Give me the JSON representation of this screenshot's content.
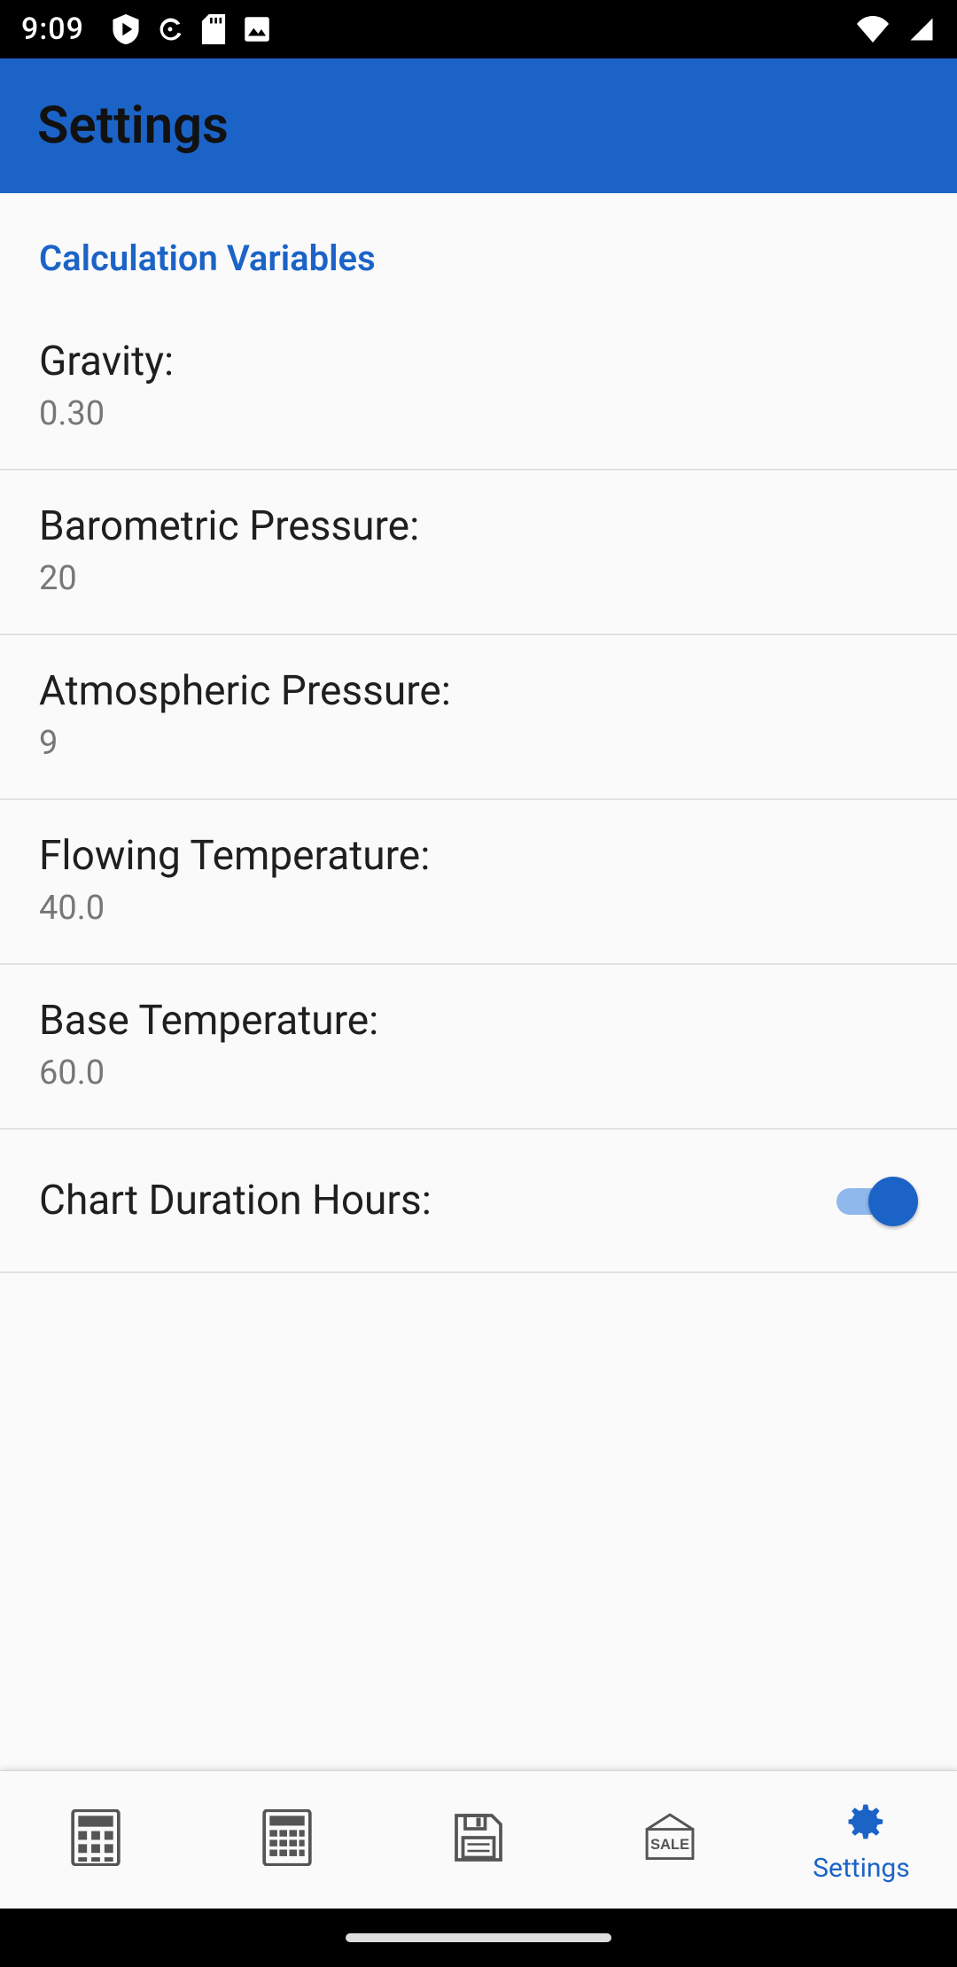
{
  "status": {
    "time": "9:09",
    "icons_left": [
      "play-shield-icon",
      "sync-icon",
      "sd-card-icon",
      "picture-icon"
    ],
    "icons_right": [
      "wifi-icon",
      "cell-signal-icon"
    ]
  },
  "header": {
    "title": "Settings"
  },
  "section": {
    "title": "Calculation Variables"
  },
  "settings": [
    {
      "label": "Gravity:",
      "value": "0.30"
    },
    {
      "label": "Barometric Pressure:",
      "value": "20"
    },
    {
      "label": "Atmospheric Pressure:",
      "value": "9"
    },
    {
      "label": "Flowing Temperature:",
      "value": "40.0"
    },
    {
      "label": "Base Temperature:",
      "value": "60.0"
    }
  ],
  "toggle": {
    "label": "Chart Duration Hours:",
    "on": true
  },
  "nav": {
    "active_index": 4,
    "items": [
      {
        "icon": "calculator-basic-icon",
        "label": ""
      },
      {
        "icon": "calculator-advanced-icon",
        "label": ""
      },
      {
        "icon": "save-icon",
        "label": ""
      },
      {
        "icon": "sale-icon",
        "label": ""
      },
      {
        "icon": "gear-icon",
        "label": "Settings"
      }
    ]
  },
  "colors": {
    "accent": "#1c63c7",
    "accent_light": "#8fb8ec"
  }
}
